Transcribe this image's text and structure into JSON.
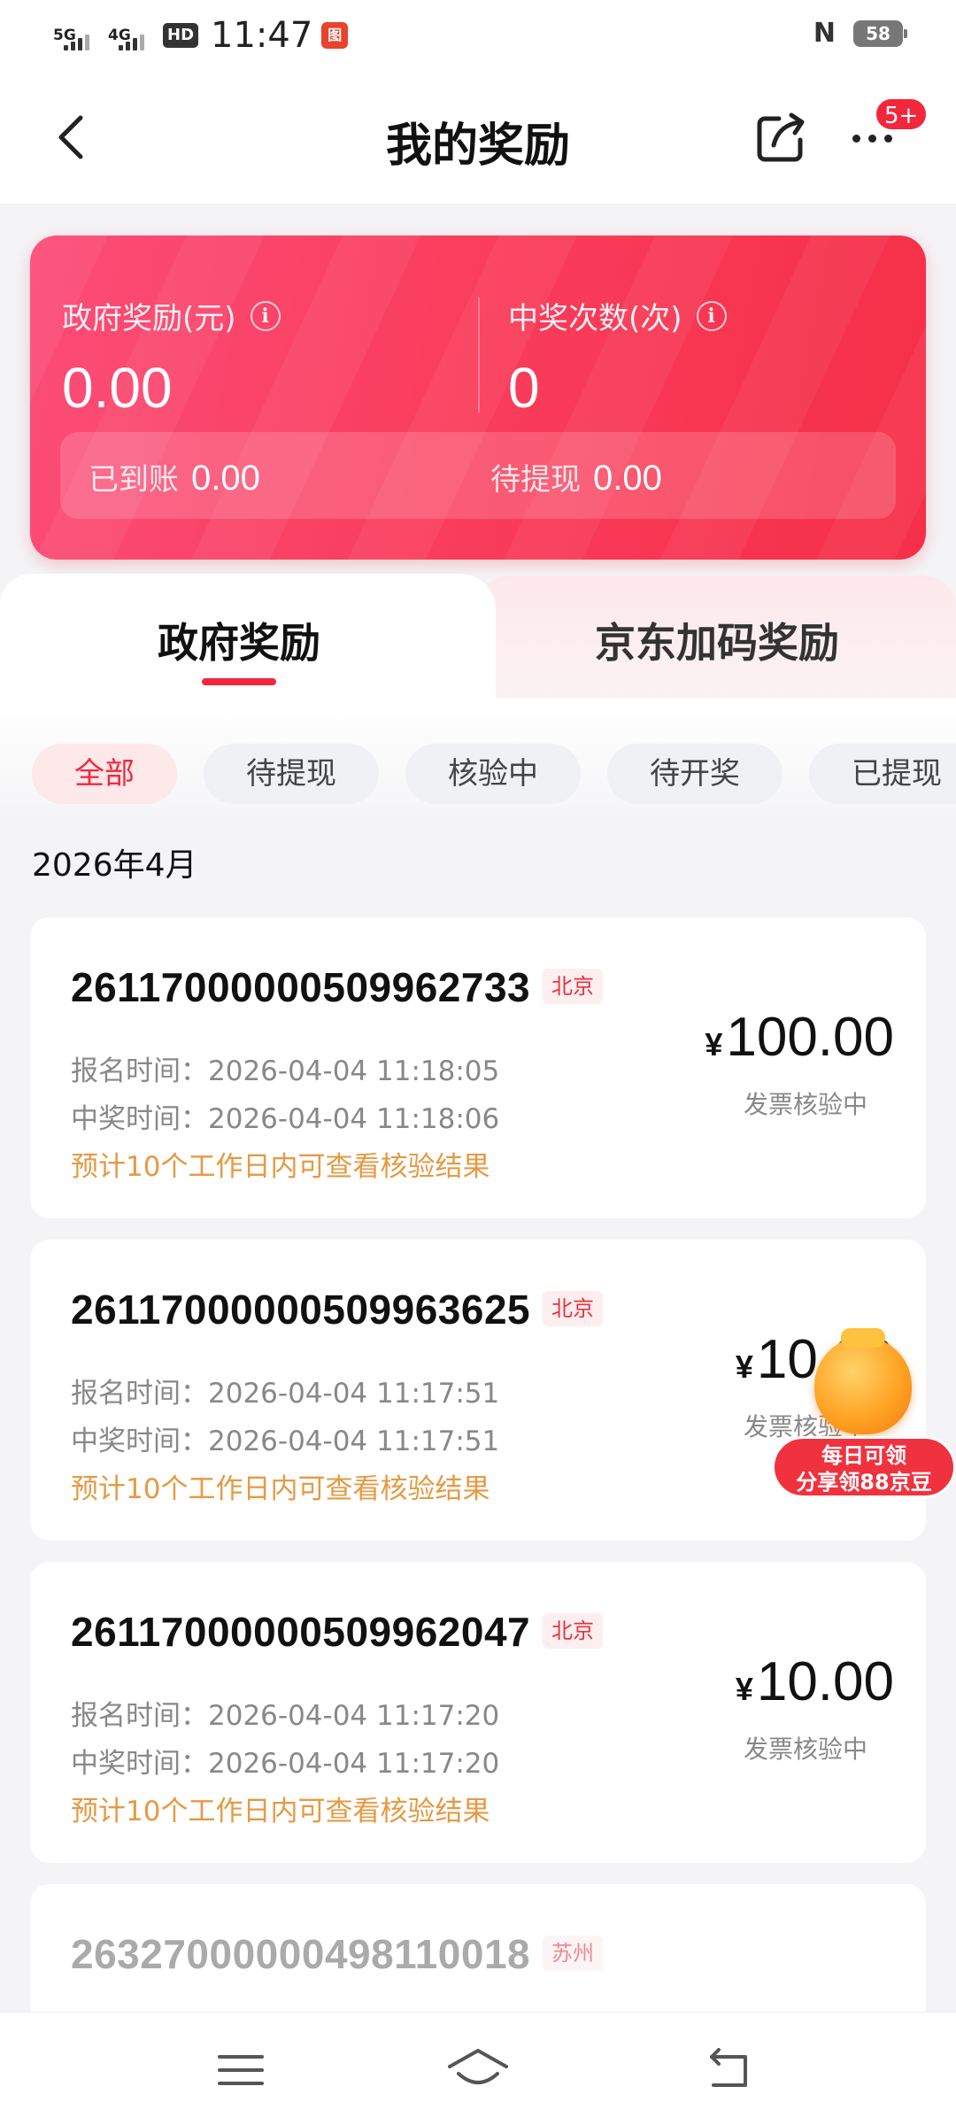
{
  "status_bar": {
    "net1": "5G",
    "net2": "4G",
    "hd_label": "HD",
    "time": "11:47",
    "battery": "58"
  },
  "header": {
    "title": "我的奖励",
    "notif_badge": "5+"
  },
  "summary": {
    "gov_label": "政府奖励(元)",
    "gov_value": "0.00",
    "win_label": "中奖次数(次)",
    "win_value": "0",
    "credited_label": "已到账",
    "credited_value": "0.00",
    "pending_label": "待提现",
    "pending_value": "0.00"
  },
  "tabs": [
    {
      "label": "政府奖励",
      "active": true
    },
    {
      "label": "京东加码奖励",
      "active": false
    }
  ],
  "filters": [
    {
      "label": "全部",
      "active": true
    },
    {
      "label": "待提现",
      "active": false
    },
    {
      "label": "核验中",
      "active": false
    },
    {
      "label": "待开奖",
      "active": false
    },
    {
      "label": "已提现",
      "active": false
    }
  ],
  "month": "2026年4月",
  "records": [
    {
      "id": "261170000005099627 33",
      "city": "北京",
      "signup": "报名时间：2026-04-04 11:18:05",
      "win": "中奖时间：2026-04-04 11:18:06",
      "note": "预计10个工作日内可查看核验结果",
      "currency": "¥",
      "amount": "100.00",
      "status": "发票核验中"
    },
    {
      "id": "261170000005099636 25",
      "city": "北京",
      "signup": "报名时间：2026-04-04 11:17:51",
      "win": "中奖时间：2026-04-04 11:17:51",
      "note": "预计10个工作日内可查看核验结果",
      "currency": "¥",
      "amount": "10.00",
      "status": "发票核验中"
    },
    {
      "id": "261170000005099620 47",
      "city": "北京",
      "signup": "报名时间：2026-04-04 11:17:20",
      "win": "中奖时间：2026-04-04 11:17:20",
      "note": "预计10个工作日内可查看核验结果",
      "currency": "¥",
      "amount": "10.00",
      "status": "发票核验中"
    },
    {
      "id": "263270000004981100 18",
      "city": "苏州"
    }
  ],
  "promo": {
    "line1": "每日可领",
    "line2": "分享领88京豆"
  }
}
